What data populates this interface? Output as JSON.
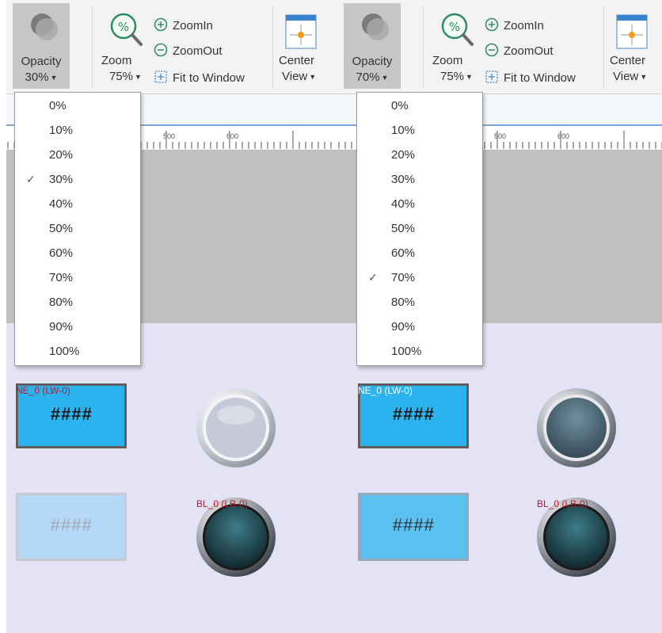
{
  "panels": [
    {
      "opacity": {
        "label": "Opacity",
        "value": "30%"
      },
      "zoom": {
        "label": "Zoom",
        "value": "75%",
        "zoom_in": "ZoomIn",
        "zoom_out": "ZoomOut",
        "fit": "Fit to Window"
      },
      "center_view": {
        "label1": "Center",
        "label2": "View"
      },
      "ruler": {
        "mark1": "500",
        "mark2": "600"
      },
      "dropdown": {
        "options": [
          "0%",
          "10%",
          "20%",
          "30%",
          "40%",
          "50%",
          "60%",
          "70%",
          "80%",
          "90%",
          "100%"
        ],
        "checked": "30%"
      },
      "numeric_display_1": {
        "tag": "NE_0 (LW-0)",
        "text": "####",
        "fill": "#2ab3ef"
      },
      "numeric_display_2": {
        "text": "####",
        "fill": "#b5d8f6"
      },
      "lamp_1_color": "#c6c9d8",
      "lamp_2": {
        "tag": "BL_0 (LB-0)",
        "color": "#1d4a55"
      }
    },
    {
      "opacity": {
        "label": "Opacity",
        "value": "70%"
      },
      "zoom": {
        "label": "Zoom",
        "value": "75%",
        "zoom_in": "ZoomIn",
        "zoom_out": "ZoomOut",
        "fit": "Fit to Window"
      },
      "center_view": {
        "label1": "Center",
        "label2": "View"
      },
      "ruler": {
        "mark1": "500",
        "mark2": "600"
      },
      "dropdown": {
        "options": [
          "0%",
          "10%",
          "20%",
          "30%",
          "40%",
          "50%",
          "60%",
          "70%",
          "80%",
          "90%",
          "100%"
        ],
        "checked": "70%"
      },
      "numeric_display_1": {
        "tag": "NE_0 (LW-0)",
        "text": "####",
        "fill": "#2ab3ef"
      },
      "numeric_display_2": {
        "text": "####",
        "fill": "#5bc1f0"
      },
      "lamp_1_color": "#5b7a8c",
      "lamp_2": {
        "tag": "BL_0 (LB-0)",
        "color": "#1d4a55"
      }
    }
  ],
  "icons": {
    "opacity": "opacity-icon",
    "zoom": "magnifier-percent-icon",
    "zoom_in": "zoom-in-icon",
    "zoom_out": "zoom-out-icon",
    "fit": "fit-window-icon",
    "center": "center-view-icon",
    "check": "checkmark-icon",
    "caret": "caret-down-icon"
  }
}
